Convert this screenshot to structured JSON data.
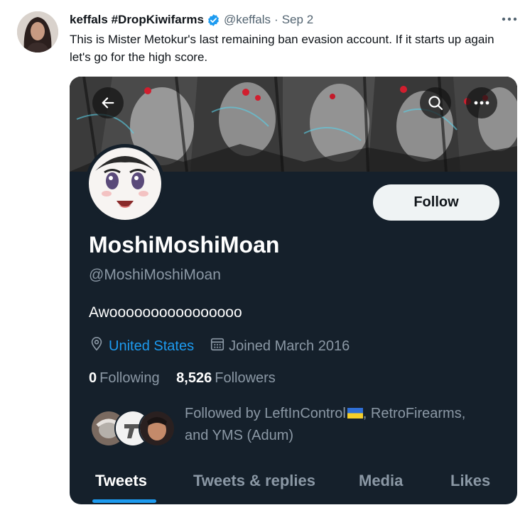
{
  "tweet": {
    "author_name": "keffals #DropKiwifarms",
    "handle": "@keffals",
    "separator": "·",
    "date": "Sep 2",
    "text": "This is Mister Metokur's last remaining ban evasion account. If it starts up again let's go for the high score.",
    "more_icon": "ellipsis-icon",
    "verified_icon": "verified-badge-icon"
  },
  "profile_card": {
    "display_name": "MoshiMoshiMoan",
    "handle": "@MoshiMoshiMoan",
    "bio": "Awoooooooooooooooo",
    "location": "United States",
    "joined": "Joined March 2016",
    "follow_label": "Follow",
    "following_count": "0",
    "following_label": "Following",
    "followers_count": "8,526",
    "followers_label": "Followers",
    "followed_by_prefix": "Followed by LeftInControl",
    "followed_by_rest": ", RetroFirearms,",
    "followed_by_line2": "and YMS (Adum)",
    "tabs": [
      {
        "label": "Tweets",
        "active": true
      },
      {
        "label": "Tweets & replies",
        "active": false
      },
      {
        "label": "Media",
        "active": false
      },
      {
        "label": "Likes",
        "active": false
      }
    ],
    "banner_buttons": [
      "back-arrow-icon",
      "search-icon",
      "more-icon"
    ]
  },
  "colors": {
    "card_background": "#15202b",
    "accent": "#1d9bf0",
    "muted_text": "#8b98a5",
    "follow_button": "#eff3f4",
    "verified": "#1d9bf0"
  }
}
